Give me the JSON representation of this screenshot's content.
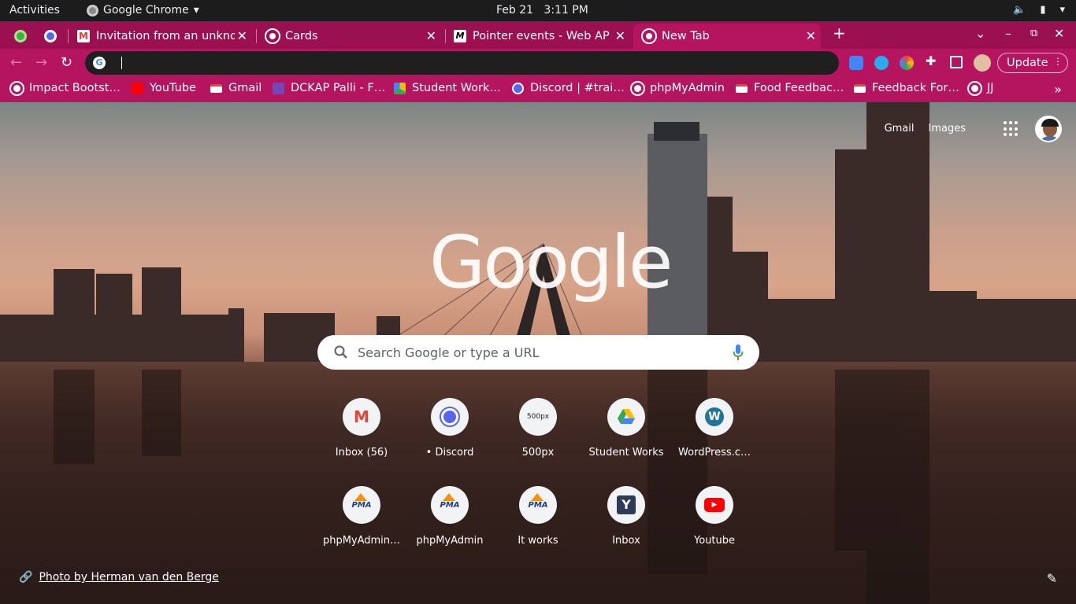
{
  "system": {
    "activities": "Activities",
    "app_name": "Google Chrome",
    "date": "Feb 21",
    "time": "3:11 PM"
  },
  "tabs": [
    {
      "title": "",
      "icon": "spinner-icon"
    },
    {
      "title": "Invitation from an unknown",
      "icon": "gmail-icon"
    },
    {
      "title": "Cards",
      "icon": "globe-icon"
    },
    {
      "title": "Pointer events - Web APIs",
      "icon": "mdn-icon"
    },
    {
      "title": "New Tab",
      "icon": "chrome-icon",
      "active": true
    }
  ],
  "toolbar": {
    "omnibox_value": "",
    "update_label": "Update"
  },
  "bookmarks": [
    {
      "label": "Impact Bootst…",
      "icon": "globe-icon"
    },
    {
      "label": "YouTube",
      "icon": "youtube-icon"
    },
    {
      "label": "Gmail",
      "icon": "gmail-icon"
    },
    {
      "label": "DCKAP Palli - F…",
      "icon": "forms-icon"
    },
    {
      "label": "Student Work…",
      "icon": "drive-icon"
    },
    {
      "label": "Discord | #trai…",
      "icon": "discord-icon"
    },
    {
      "label": "phpMyAdmin",
      "icon": "globe-icon"
    },
    {
      "label": "Food Feedbac…",
      "icon": "gmail-icon"
    },
    {
      "label": "Feedback For…",
      "icon": "gmail-icon"
    },
    {
      "label": "JJ",
      "icon": "globe-icon"
    }
  ],
  "ntp": {
    "gmail_link": "Gmail",
    "images_link": "Images",
    "logo": "Google",
    "search_placeholder": "Search Google or type a URL",
    "shortcuts": [
      {
        "label": "Inbox (56)",
        "icon": "gmail-icon"
      },
      {
        "label": "• Discord",
        "icon": "discord-icon"
      },
      {
        "label": "500px",
        "icon": "500px-icon"
      },
      {
        "label": "Student Works",
        "icon": "drive-icon"
      },
      {
        "label": "WordPress.c…",
        "icon": "wordpress-icon"
      },
      {
        "label": "phpMyAdmin…",
        "icon": "phpmyadmin-icon"
      },
      {
        "label": "phpMyAdmin",
        "icon": "phpmyadmin-icon"
      },
      {
        "label": "It works",
        "icon": "phpmyadmin-icon"
      },
      {
        "label": "Inbox",
        "icon": "yahoo-icon"
      },
      {
        "label": "Youtube",
        "icon": "youtube-icon"
      }
    ],
    "photo_credit": "Photo by Herman van den Berge"
  },
  "colors": {
    "tabstrip": "#9b1050",
    "toolbar": "#b5145f",
    "topbar": "#1c1c1c"
  }
}
